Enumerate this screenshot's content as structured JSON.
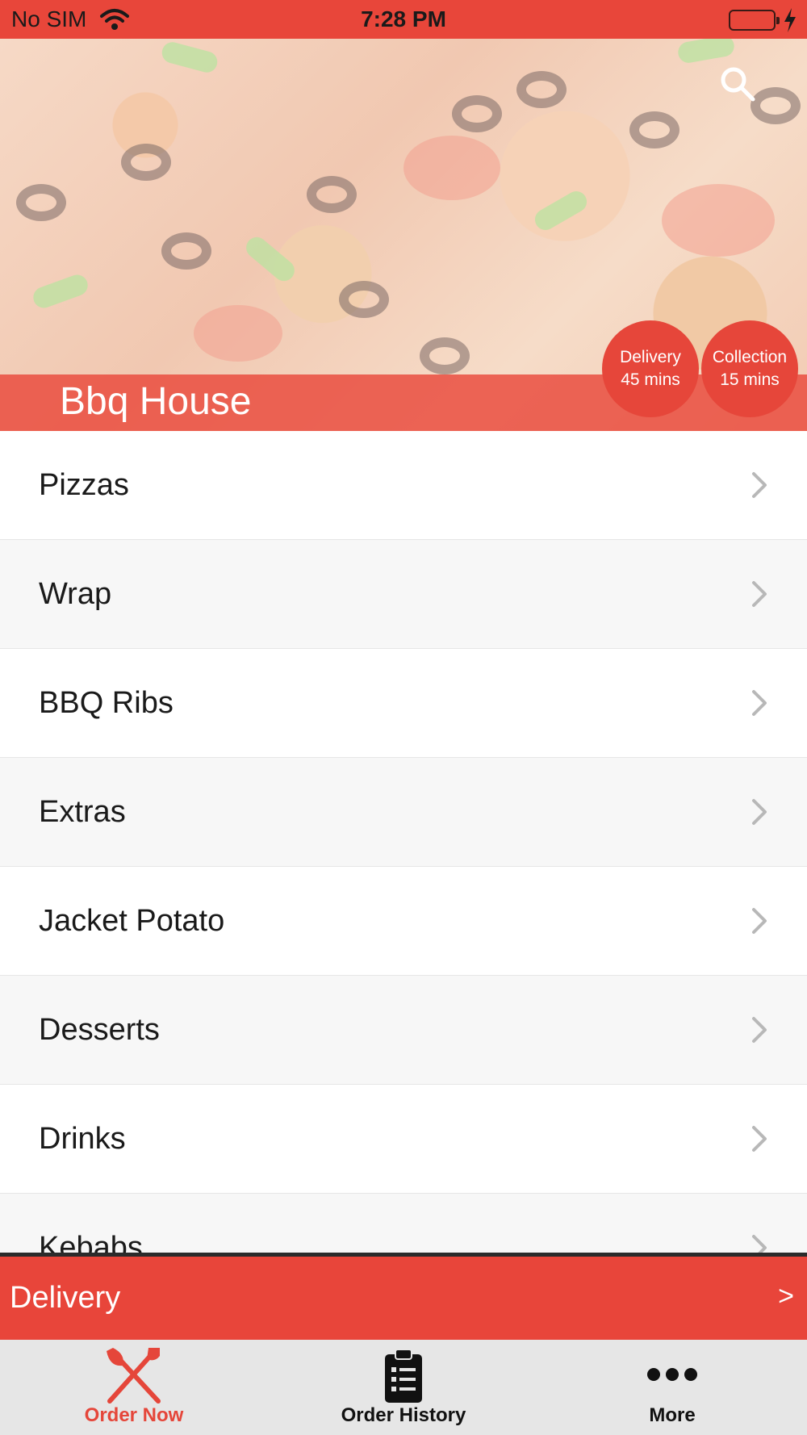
{
  "status_bar": {
    "carrier": "No SIM",
    "time": "7:28 PM",
    "wifi_icon": "wifi-icon",
    "battery_icon": "battery-charging-icon"
  },
  "header": {
    "restaurant_name": "Bbq House",
    "search_icon": "search-icon",
    "delivery_time": {
      "label": "Delivery",
      "value": "45 mins"
    },
    "collection_time": {
      "label": "Collection",
      "value": "15 mins"
    }
  },
  "categories": [
    {
      "label": "Pizzas"
    },
    {
      "label": "Wrap"
    },
    {
      "label": "BBQ Ribs"
    },
    {
      "label": "Extras"
    },
    {
      "label": "Jacket Potato"
    },
    {
      "label": "Desserts"
    },
    {
      "label": "Drinks"
    },
    {
      "label": "Kebabs"
    }
  ],
  "delivery_bar": {
    "label": "Delivery",
    "arrow": ">"
  },
  "tab_bar": {
    "tabs": [
      {
        "label": "Order Now",
        "icon": "fork-knife-icon",
        "active": true
      },
      {
        "label": "Order History",
        "icon": "clipboard-list-icon",
        "active": false
      },
      {
        "label": "More",
        "icon": "more-dots-icon",
        "active": false
      }
    ]
  },
  "colors": {
    "accent": "#e8463a",
    "active_tab": "#e5463a",
    "inactive_tab": "#111111"
  }
}
